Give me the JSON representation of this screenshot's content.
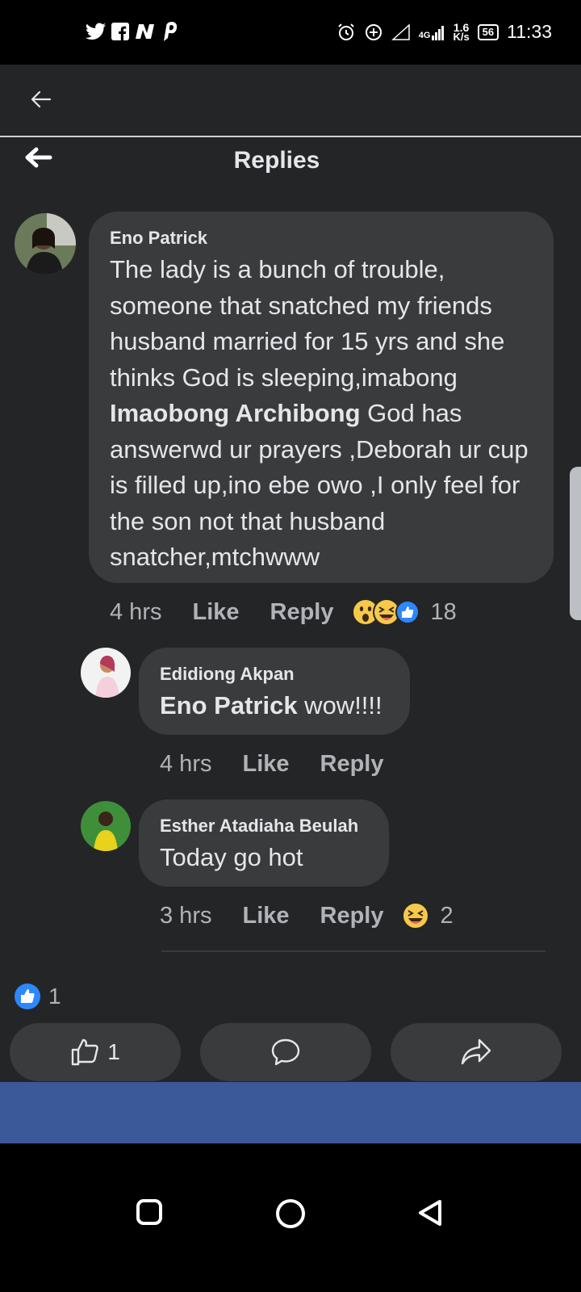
{
  "status_bar": {
    "app_icons": [
      "twitter-icon",
      "facebook-icon",
      "n-icon",
      "pinterest-icon"
    ],
    "network": "4G",
    "speed": "1.6",
    "speed_unit": "K/s",
    "battery": "56",
    "time": "11:33"
  },
  "header": {
    "title": "Replies"
  },
  "comments": [
    {
      "author": "Eno Patrick",
      "text_before": "The lady is a bunch of trouble, someone that snatched my friends husband married for 15 yrs and she thinks God is sleeping,imabong ",
      "mention": "Imaobong Archibong",
      "text_after": " God has answerwd ur prayers ,Deborah ur cup is filled up,ino ebe owo ,I only feel for the son not that husband snatcher,mtchwww",
      "time": "4 hrs",
      "like_label": "Like",
      "reply_label": "Reply",
      "reaction_count": "18",
      "reactions": [
        "wow-reaction-icon",
        "haha-reaction-icon",
        "like-reaction-icon"
      ]
    },
    {
      "author": "Edidiong Akpan",
      "mention": "Eno Patrick",
      "text_after": " wow!!!!",
      "time": "4 hrs",
      "like_label": "Like",
      "reply_label": "Reply"
    },
    {
      "author": "Esther Atadiaha Beulah",
      "text": "Today go hot",
      "time": "3 hrs",
      "like_label": "Like",
      "reply_label": "Reply",
      "reaction_count": "2",
      "reactions": [
        "haha-reaction-icon"
      ]
    }
  ],
  "post_footer": {
    "like_count": "1",
    "like_button_count": "1",
    "buttons": [
      "like-icon",
      "comment-icon",
      "share-icon"
    ]
  },
  "colors": {
    "background": "#242527",
    "bubble": "#3a3b3c",
    "like_blue": "#2d88ff",
    "nav_blue": "#3b5998"
  }
}
